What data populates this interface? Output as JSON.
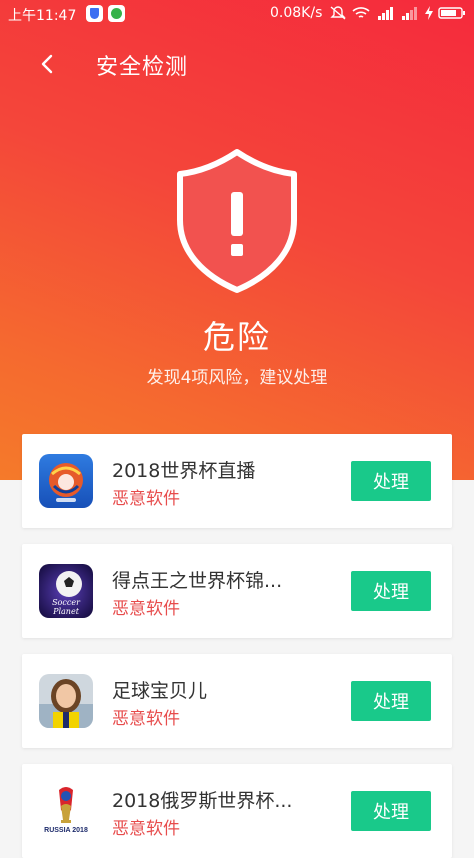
{
  "status_bar": {
    "time": "上午11:47",
    "speed": "0.08K/s"
  },
  "header": {
    "title": "安全检测"
  },
  "summary": {
    "status": "危险",
    "message": "发现4项风险，建议处理"
  },
  "colors": {
    "danger_gradient_top": "#f52a3c",
    "danger_gradient_bottom": "#f57a2a",
    "action_green": "#19c98a",
    "tag_red": "#e74c4c"
  },
  "apps": [
    {
      "name": "2018世界杯直播",
      "tag": "恶意软件",
      "action": "处理",
      "icon": "world-cup-ball-icon"
    },
    {
      "name": "得点王之世界杯锦...",
      "tag": "恶意软件",
      "action": "处理",
      "icon": "soccer-planet-icon"
    },
    {
      "name": "足球宝贝儿",
      "tag": "恶意软件",
      "action": "处理",
      "icon": "soccer-girl-avatar-icon"
    },
    {
      "name": "2018俄罗斯世界杯...",
      "tag": "恶意软件",
      "action": "处理",
      "icon": "russia-2018-logo-icon"
    }
  ],
  "icon_texts": {
    "soccer_planet": "Soccer Planet",
    "russia_2018": "RUSSIA 2018"
  }
}
